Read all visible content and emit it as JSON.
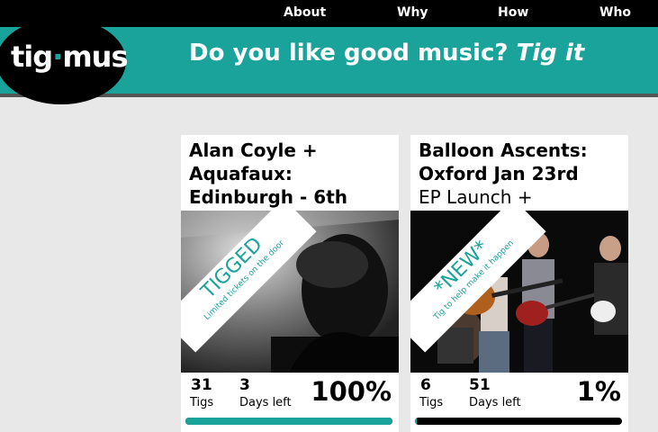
{
  "nav": {
    "about": "About",
    "why": "Why",
    "how": "How",
    "who": "Who"
  },
  "logo": {
    "part1": "tig",
    "part2": "mus"
  },
  "tagline": {
    "main": "Do you like good music?",
    "emph": "Tig it"
  },
  "cards": [
    {
      "title": "Alan Coyle + Aquafaux: Edinburgh - 6th",
      "subtitle": "",
      "ribbon_big": "TIGGED",
      "ribbon_small": "Limited tickets on the door",
      "tigs": "31",
      "tigs_label": "Tigs",
      "days": "3",
      "days_label": "Days left",
      "percent_label": "100%",
      "progress": 1.0
    },
    {
      "title": "Balloon Ascents: Oxford Jan 23rd",
      "subtitle": "EP Launch +",
      "ribbon_big": "*NEW*",
      "ribbon_small": "Tig to help make it happen",
      "tigs": "6",
      "tigs_label": "Tigs",
      "days": "51",
      "days_label": "Days left",
      "percent_label": "1%",
      "progress": 0.01
    }
  ],
  "colors": {
    "accent": "#1aa39a",
    "nav_bg": "#000000",
    "page_bg": "#e8e8e8"
  }
}
